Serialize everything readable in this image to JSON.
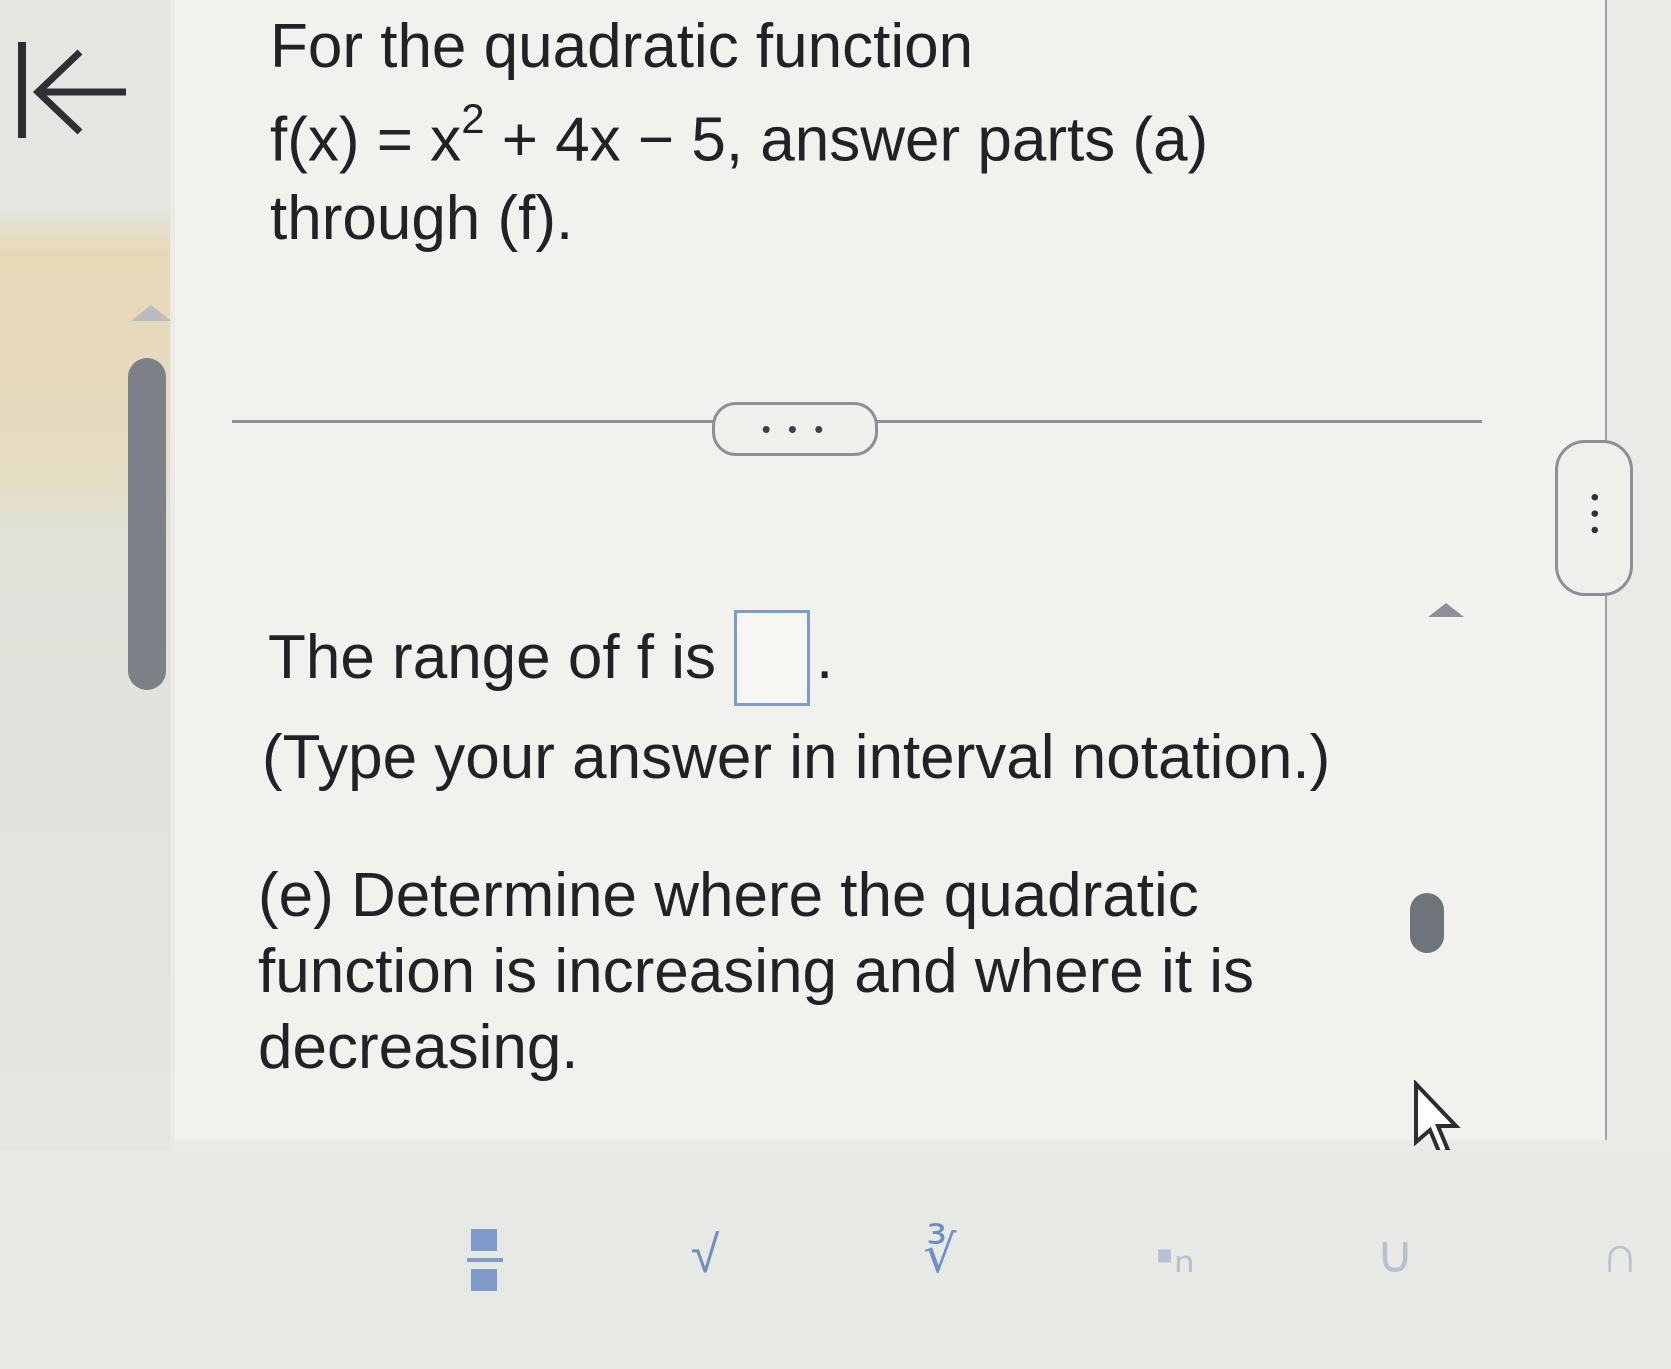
{
  "nav": {
    "back_label": "K←"
  },
  "question": {
    "line1": "For the quadratic function",
    "fx_prefix": "f(x) = x",
    "exponent": "2",
    "fx_suffix": " + 4x − 5, answer parts (a)",
    "line3": "through (f)."
  },
  "more_button": {
    "label": "• • •"
  },
  "side_more_button": {
    "label": "•••"
  },
  "range": {
    "prefix": "The range of f is",
    "suffix": ".",
    "answer_value": ""
  },
  "hint": "(Type your answer in interval notation.)",
  "part_e": "(e) Determine where the quadratic function is increasing and where it is decreasing.",
  "toolbar": {
    "tools": [
      {
        "name": "fraction",
        "icon": "fraction-icon"
      },
      {
        "name": "square-root",
        "icon": "sqrt-icon",
        "glyph": "√"
      },
      {
        "name": "nth-root",
        "icon": "nth-root-icon",
        "glyph": "∛"
      },
      {
        "name": "subscript",
        "icon": "subscript-icon",
        "glyph": "▪ₙ"
      },
      {
        "name": "union",
        "icon": "union-icon",
        "glyph": "∪"
      },
      {
        "name": "intersection",
        "icon": "intersection-icon",
        "glyph": "∩"
      }
    ]
  },
  "colors": {
    "accent": "#7a9ccf",
    "text": "#222226",
    "scrollbar": "#7c8087"
  }
}
